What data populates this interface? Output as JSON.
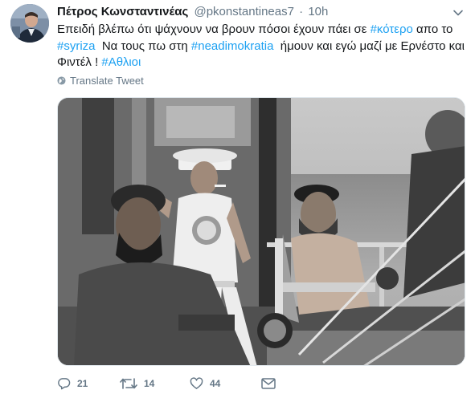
{
  "tweet": {
    "author_name": "Πέτρος Κωνσταντινέας",
    "handle": "@pkonstantineas7",
    "separator": "·",
    "time": "10h",
    "text": {
      "l1_pre": "Επειδή βλέπω ότι ψάχνουν να βρουν πόσοι έχουν πάει σε ",
      "l1_tag": "#κότερο",
      "l1_post": " απο το",
      "l2_tag1": "#syriza",
      "l2_mid": "  Να τους πω στη ",
      "l2_tag2": "#neadimokratia",
      "l2_post": "  ήμουν και εγώ μαζί με Ερνέστο και",
      "l3_pre": "Φιντέλ ! ",
      "l3_tag": "#Αθλιοι"
    },
    "translate_label": "Translate Tweet"
  },
  "actions": {
    "reply_count": "21",
    "retweet_count": "14",
    "like_count": "44"
  },
  "icons": {
    "reply": "reply-icon",
    "retweet": "retweet-icon",
    "like": "heart-icon",
    "dm": "envelope-icon",
    "translate": "globe-icon",
    "more": "chevron-down-icon"
  },
  "colors": {
    "link": "#1da1f2",
    "meta": "#657786",
    "text": "#14171a"
  }
}
